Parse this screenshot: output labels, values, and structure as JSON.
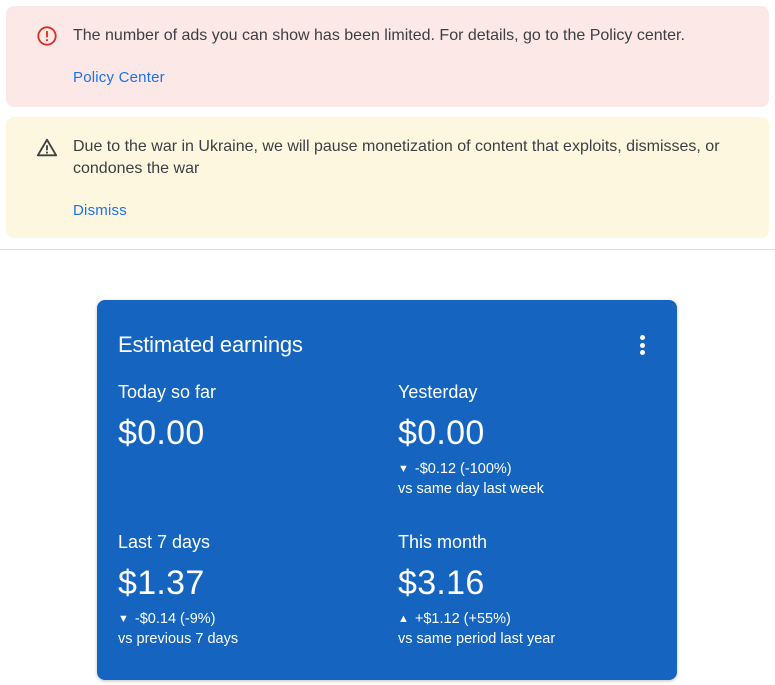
{
  "alerts": {
    "error": {
      "message": "The number of ads you can show has been limited. For details, go to the Policy center.",
      "link_label": "Policy Center",
      "icon": "error-circle-icon",
      "color": "#d93025"
    },
    "warning": {
      "message": "Due to the war in Ukraine, we will pause monetization of content that exploits, dismisses, or condones the war",
      "link_label": "Dismiss",
      "icon": "warning-triangle-icon",
      "color": "#3c4043"
    }
  },
  "earnings_card": {
    "title": "Estimated earnings",
    "background": "#1565c0",
    "menu_icon": "more-vert-icon",
    "metrics": {
      "today": {
        "label": "Today so far",
        "value": "$0.00"
      },
      "yesterday": {
        "label": "Yesterday",
        "value": "$0.00",
        "trend": "down",
        "delta": "-$0.12 (-100%)",
        "compare": "vs same day last week"
      },
      "last7": {
        "label": "Last 7 days",
        "value": "$1.37",
        "trend": "down",
        "delta": "-$0.14 (-9%)",
        "compare": "vs previous 7 days"
      },
      "month": {
        "label": "This month",
        "value": "$3.16",
        "trend": "up",
        "delta": "+$1.12 (+55%)",
        "compare": "vs same period last year"
      }
    }
  },
  "arrows": {
    "down": "▼",
    "up": "▲"
  }
}
